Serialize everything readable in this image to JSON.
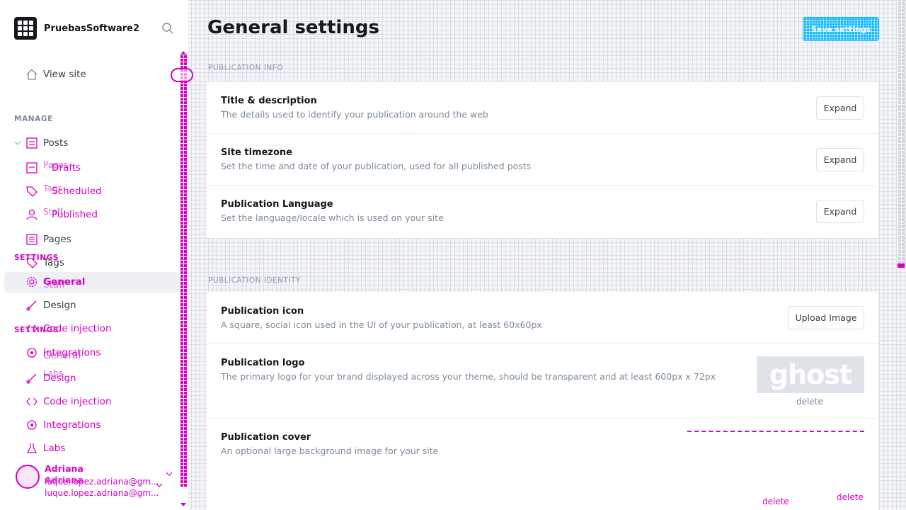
{
  "app": {
    "site_name": "PruebasSoftware2",
    "user_name": "Adriana",
    "user_email": "luque.lopez.adriana@gm..."
  },
  "sidebar": {
    "view_site": "View site",
    "manage_label": "MANAGE",
    "posts": "Posts",
    "drafts": "Drafts",
    "scheduled": "Scheduled",
    "published": "Published",
    "pages": "Pages",
    "tags": "Tags",
    "staff": "Staff",
    "ghost_under_drafts": "Pages",
    "ghost_under_scheduled": "Tags",
    "ghost_under_published": "Staff",
    "settings_label": "SETTINGS",
    "general": "General",
    "design": "Design",
    "code_injection": "Code injection",
    "integrations": "Integrations",
    "labs": "Labs",
    "ghost_general": "General",
    "ghost_design": "Design",
    "ghost_code_injection": "Code injection",
    "ghost_integrations": "Integrations",
    "ghost_labs": "Labs",
    "ghost_settings_label": "SETTINGS"
  },
  "main": {
    "title": "General settings",
    "save_button": "Save settings",
    "sections": {
      "info_label": "PUBLICATION INFO",
      "identity_label": "PUBLICATION IDENTITY"
    },
    "info_rows": [
      {
        "title": "Title & description",
        "desc": "The details used to identify your publication around the web",
        "button": "Expand"
      },
      {
        "title": "Site timezone",
        "desc": "Set the time and date of your publication, used for all published posts",
        "button": "Expand"
      },
      {
        "title": "Publication Language",
        "desc": "Set the language/locale which is used on your site",
        "button": "Expand"
      }
    ],
    "identity_rows": [
      {
        "title": "Publication icon",
        "desc": "A square, social icon used in the UI of your publication, at least 60x60px",
        "button": "Upload Image"
      },
      {
        "title": "Publication logo",
        "desc": "The primary logo for your brand displayed across your theme, should be transparent and at least 600px x 72px",
        "logo_text": "ghost",
        "delete": "delete"
      },
      {
        "title": "Publication cover",
        "desc": "An optional large background image for your site",
        "delete": "delete",
        "delete_ghost": "delete"
      }
    ]
  },
  "colors": {
    "accent": "#14b8ff",
    "overlay": "#d400c4",
    "text": "#394047",
    "muted": "#7c8b9a"
  }
}
